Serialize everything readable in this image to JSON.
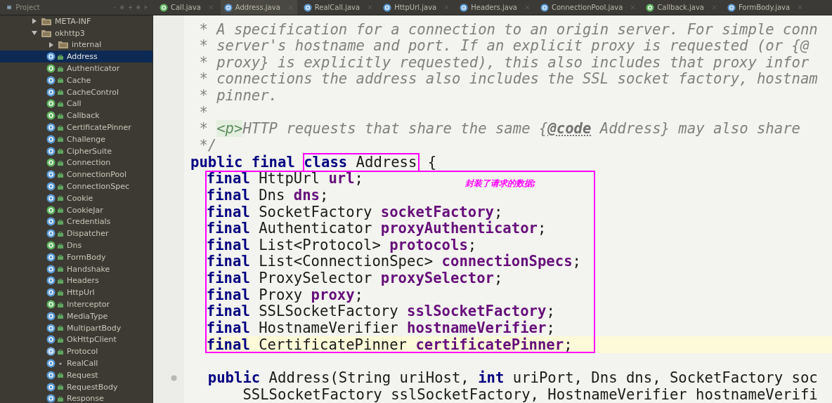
{
  "project_panel": {
    "title": "Project"
  },
  "tabs": [
    {
      "label": "Call.java",
      "kind": "interface",
      "selected": false
    },
    {
      "label": "Address.java",
      "kind": "class",
      "selected": true
    },
    {
      "label": "RealCall.java",
      "kind": "class",
      "selected": false
    },
    {
      "label": "HttpUrl.java",
      "kind": "class",
      "selected": false
    },
    {
      "label": "Headers.java",
      "kind": "class",
      "selected": false
    },
    {
      "label": "ConnectionPool.java",
      "kind": "class",
      "selected": false
    },
    {
      "label": "Callback.java",
      "kind": "interface",
      "selected": false
    },
    {
      "label": "FormBody.java",
      "kind": "class",
      "selected": false
    }
  ],
  "tree": [
    {
      "label": "META-INF",
      "kind": "folder",
      "expanded": false,
      "selected": false
    },
    {
      "label": "okhttp3",
      "kind": "folder",
      "expanded": true,
      "selected": false,
      "children": [
        {
          "label": "internal",
          "kind": "folder",
          "expanded": false,
          "selected": false
        },
        {
          "label": "Address",
          "kind": "class",
          "public": true,
          "selected": true
        },
        {
          "label": "Authenticator",
          "kind": "interface",
          "public": true,
          "selected": false
        },
        {
          "label": "Cache",
          "kind": "class",
          "public": true,
          "selected": false
        },
        {
          "label": "CacheControl",
          "kind": "class",
          "public": true,
          "selected": false
        },
        {
          "label": "Call",
          "kind": "interface",
          "public": true,
          "selected": false
        },
        {
          "label": "Callback",
          "kind": "interface",
          "public": true,
          "selected": false
        },
        {
          "label": "CertificatePinner",
          "kind": "class",
          "public": true,
          "selected": false
        },
        {
          "label": "Challenge",
          "kind": "class",
          "public": true,
          "selected": false
        },
        {
          "label": "CipherSuite",
          "kind": "class",
          "public": true,
          "selected": false
        },
        {
          "label": "Connection",
          "kind": "interface",
          "public": true,
          "selected": false
        },
        {
          "label": "ConnectionPool",
          "kind": "class",
          "public": true,
          "selected": false
        },
        {
          "label": "ConnectionSpec",
          "kind": "class",
          "public": true,
          "selected": false
        },
        {
          "label": "Cookie",
          "kind": "class",
          "public": true,
          "selected": false
        },
        {
          "label": "CookieJar",
          "kind": "interface",
          "public": true,
          "selected": false
        },
        {
          "label": "Credentials",
          "kind": "class",
          "public": true,
          "selected": false
        },
        {
          "label": "Dispatcher",
          "kind": "class",
          "public": true,
          "selected": false
        },
        {
          "label": "Dns",
          "kind": "interface",
          "public": true,
          "selected": false
        },
        {
          "label": "FormBody",
          "kind": "class",
          "public": true,
          "selected": false
        },
        {
          "label": "Handshake",
          "kind": "class",
          "public": true,
          "selected": false
        },
        {
          "label": "Headers",
          "kind": "class",
          "public": true,
          "selected": false
        },
        {
          "label": "HttpUrl",
          "kind": "class",
          "public": true,
          "selected": false
        },
        {
          "label": "Interceptor",
          "kind": "interface",
          "public": true,
          "selected": false
        },
        {
          "label": "MediaType",
          "kind": "class",
          "public": true,
          "selected": false
        },
        {
          "label": "MultipartBody",
          "kind": "class",
          "public": true,
          "selected": false
        },
        {
          "label": "OkHttpClient",
          "kind": "class",
          "public": true,
          "selected": false
        },
        {
          "label": "Protocol",
          "kind": "enum",
          "public": true,
          "selected": false
        },
        {
          "label": "RealCall",
          "kind": "class",
          "public": false,
          "selected": false
        },
        {
          "label": "Request",
          "kind": "class",
          "public": true,
          "selected": false
        },
        {
          "label": "RequestBody",
          "kind": "class",
          "public": true,
          "selected": false
        },
        {
          "label": "Response",
          "kind": "class",
          "public": true,
          "selected": false
        }
      ]
    }
  ],
  "editor": {
    "box_note": "封装了请求的数据;",
    "lines": [
      {
        "tokens": [
          {
            "kind": "comment",
            "text": " * A specification for a connection to an origin server. For simple conn"
          }
        ]
      },
      {
        "tokens": [
          {
            "kind": "comment",
            "text": " * server's hostname and port. If an explicit proxy is requested (or {@"
          }
        ]
      },
      {
        "tokens": [
          {
            "kind": "comment",
            "text": " * proxy} is explicitly requested), this also includes that proxy infor"
          }
        ]
      },
      {
        "tokens": [
          {
            "kind": "comment",
            "text": " * connections the address also includes the SSL socket factory, hostnam"
          }
        ]
      },
      {
        "tokens": [
          {
            "kind": "comment",
            "text": " * pinner."
          }
        ]
      },
      {
        "tokens": [
          {
            "kind": "comment",
            "text": " *"
          }
        ]
      },
      {
        "tokens": [
          {
            "kind": "comment",
            "text": " * "
          },
          {
            "kind": "tag",
            "text": "<p>"
          },
          {
            "kind": "comment",
            "text": "HTTP requests that share the same {"
          },
          {
            "kind": "doc_tag",
            "text": "@code"
          },
          {
            "kind": "comment",
            "text": " Address} may also share"
          }
        ]
      },
      {
        "tokens": [
          {
            "kind": "comment",
            "text": " */"
          }
        ]
      },
      {
        "tokens": [
          {
            "kind": "keyword",
            "text": "public final "
          },
          {
            "kind": "keyword",
            "text": "class",
            "boxed": true
          },
          {
            "kind": "plain",
            "text": " Address",
            "boxed": true
          },
          {
            "kind": "plain",
            "text": " {"
          }
        ]
      },
      {
        "boxed": true,
        "tokens": [
          {
            "kind": "keyword",
            "text": "final"
          },
          {
            "kind": "plain",
            "text": " HttpUrl "
          },
          {
            "kind": "field",
            "text": "url"
          },
          {
            "kind": "plain",
            "text": ";"
          }
        ]
      },
      {
        "boxed": true,
        "tokens": [
          {
            "kind": "keyword",
            "text": "final"
          },
          {
            "kind": "plain",
            "text": " Dns "
          },
          {
            "kind": "field",
            "text": "dns"
          },
          {
            "kind": "plain",
            "text": ";"
          }
        ]
      },
      {
        "boxed": true,
        "tokens": [
          {
            "kind": "keyword",
            "text": "final"
          },
          {
            "kind": "plain",
            "text": " SocketFactory "
          },
          {
            "kind": "field",
            "text": "socketFactory"
          },
          {
            "kind": "plain",
            "text": ";"
          }
        ]
      },
      {
        "boxed": true,
        "tokens": [
          {
            "kind": "keyword",
            "text": "final"
          },
          {
            "kind": "plain",
            "text": " Authenticator "
          },
          {
            "kind": "field",
            "text": "proxyAuthenticator"
          },
          {
            "kind": "plain",
            "text": ";"
          }
        ]
      },
      {
        "boxed": true,
        "tokens": [
          {
            "kind": "keyword",
            "text": "final"
          },
          {
            "kind": "plain",
            "text": " List<Protocol> "
          },
          {
            "kind": "field",
            "text": "protocols"
          },
          {
            "kind": "plain",
            "text": ";"
          }
        ]
      },
      {
        "boxed": true,
        "tokens": [
          {
            "kind": "keyword",
            "text": "final"
          },
          {
            "kind": "plain",
            "text": " List<ConnectionSpec> "
          },
          {
            "kind": "field",
            "text": "connectionSpecs"
          },
          {
            "kind": "plain",
            "text": ";"
          }
        ]
      },
      {
        "boxed": true,
        "tokens": [
          {
            "kind": "keyword",
            "text": "final"
          },
          {
            "kind": "plain",
            "text": " ProxySelector "
          },
          {
            "kind": "field",
            "text": "proxySelector"
          },
          {
            "kind": "plain",
            "text": ";"
          }
        ]
      },
      {
        "boxed": true,
        "tokens": [
          {
            "kind": "keyword",
            "text": "final"
          },
          {
            "kind": "plain",
            "text": " Proxy "
          },
          {
            "kind": "field",
            "text": "proxy"
          },
          {
            "kind": "plain",
            "text": ";"
          }
        ]
      },
      {
        "boxed": true,
        "tokens": [
          {
            "kind": "keyword",
            "text": "final"
          },
          {
            "kind": "plain",
            "text": " SSLSocketFactory "
          },
          {
            "kind": "field",
            "text": "sslSocketFactory"
          },
          {
            "kind": "plain",
            "text": ";"
          }
        ]
      },
      {
        "boxed": true,
        "tokens": [
          {
            "kind": "keyword",
            "text": "final"
          },
          {
            "kind": "plain",
            "text": " HostnameVerifier "
          },
          {
            "kind": "field",
            "text": "hostnameVerifier"
          },
          {
            "kind": "plain",
            "text": ";"
          }
        ]
      },
      {
        "boxed": true,
        "current": true,
        "tokens": [
          {
            "kind": "keyword",
            "text": "final"
          },
          {
            "kind": "plain",
            "text": " CertificatePinner "
          },
          {
            "kind": "field",
            "text": "certificatePinner"
          },
          {
            "kind": "plain",
            "text": ";"
          }
        ]
      },
      {
        "marker": true,
        "tokens": [
          {
            "kind": "keyword",
            "text": "  public"
          },
          {
            "kind": "plain",
            "text": " Address(String uriHost, "
          },
          {
            "kind": "keyword",
            "text": "int"
          },
          {
            "kind": "plain",
            "text": " uriPort, Dns dns, SocketFactory soc"
          }
        ]
      },
      {
        "tokens": [
          {
            "kind": "plain",
            "text": "      SSLSocketFactory sslSocketFactory, HostnameVerifier hostnameVerifi"
          }
        ]
      }
    ]
  }
}
